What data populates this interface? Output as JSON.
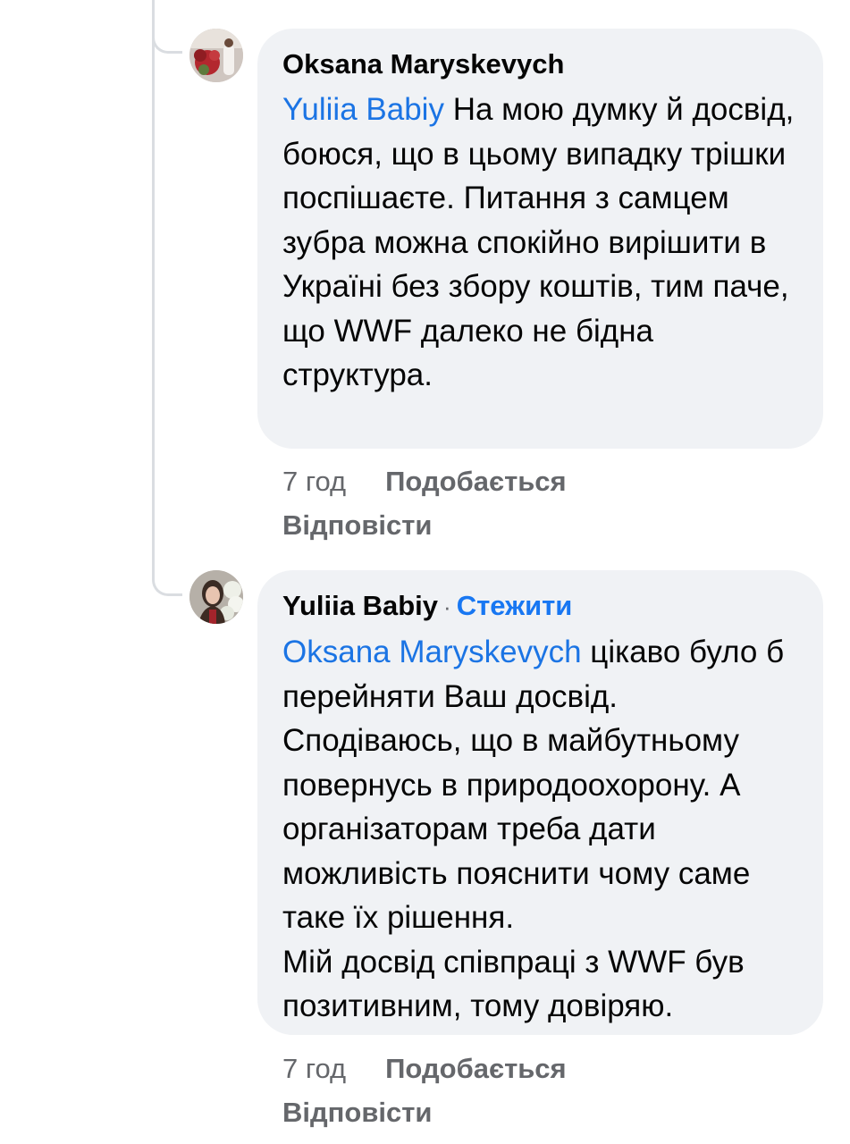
{
  "comments": [
    {
      "author": "Oksana Maryskevych",
      "mention": "Yuliia Babiy",
      "text": "На мою думку й досвід, боюся, що в цьому випадку трішки поспішаєте. Питання з самцем зубра можна спокійно вирішити в Україні без збору коштів, тим паче, що WWF далеко не бідна структура.",
      "time": "7 год",
      "like_label": "Подобається",
      "reply_label": "Відповісти"
    },
    {
      "author": "Yuliia Babiy",
      "separator": "·",
      "follow_label": "Стежити",
      "mention": "Oksana Maryskevych",
      "text": "цікаво було б перейняти Ваш досвід. Сподіваюсь, що в майбутньому повернусь в природоохорону. А організаторам треба дати можливість пояснити чому саме таке їх рішення.",
      "text2": "Мій досвід співпраці з WWF був позитивним, тому довіряю.",
      "time": "7 год",
      "like_label": "Подобається",
      "reply_label": "Відповісти"
    }
  ],
  "colors": {
    "bubble": "#f0f2f5",
    "mention": "#1b74e4",
    "follow": "#1877f2",
    "meta": "#65676b",
    "thread_line": "#dadde1"
  }
}
